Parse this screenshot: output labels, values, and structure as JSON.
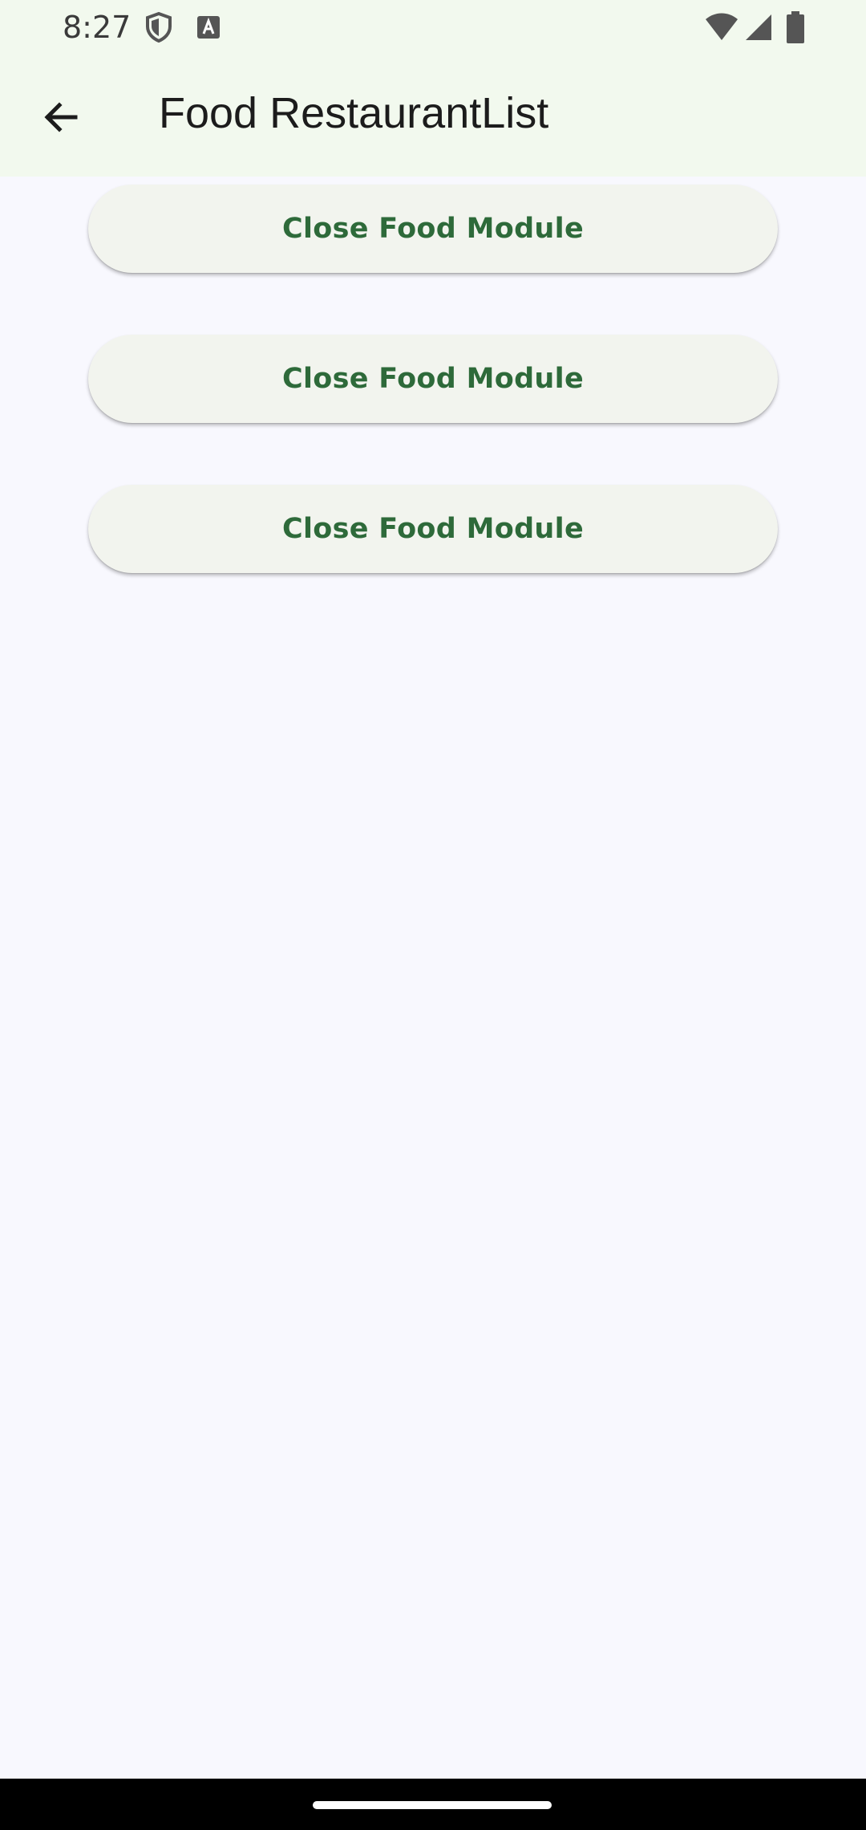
{
  "status_bar": {
    "time": "8:27",
    "icons": [
      "shield-icon",
      "font-icon",
      "wifi-icon",
      "signal-icon",
      "battery-icon"
    ]
  },
  "app_bar": {
    "back_icon": "arrow-back-icon",
    "title": "Food RestaurantList"
  },
  "buttons": [
    {
      "label": "Close Food Module"
    },
    {
      "label": "Close Food Module"
    },
    {
      "label": "Close Food Module"
    }
  ],
  "colors": {
    "app_bar_bg": "#F2F9EE",
    "page_bg": "#F8F8FE",
    "button_bg": "#F2F4EE",
    "button_text": "#2E6A3A"
  }
}
